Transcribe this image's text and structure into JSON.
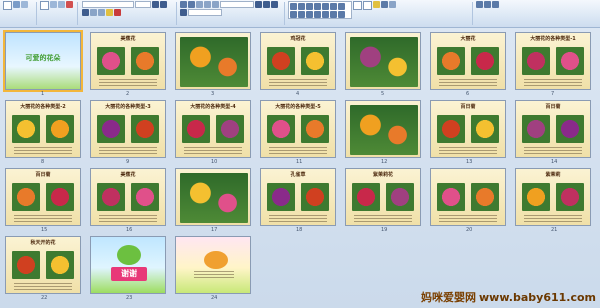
{
  "slides": [
    {
      "num": "1",
      "title": "可爱的花朵"
    },
    {
      "num": "2",
      "title": "美蕉花"
    },
    {
      "num": "3",
      "title": ""
    },
    {
      "num": "4",
      "title": "鸡冠花"
    },
    {
      "num": "5",
      "title": ""
    },
    {
      "num": "6",
      "title": "大丽花"
    },
    {
      "num": "7",
      "title": "大丽花的各种类型-1"
    },
    {
      "num": "8",
      "title": "大丽花的各种类型-2"
    },
    {
      "num": "9",
      "title": "大丽花的各种类型-3"
    },
    {
      "num": "10",
      "title": "大丽花的各种类型-4"
    },
    {
      "num": "11",
      "title": "大丽花的各种类型-5"
    },
    {
      "num": "12",
      "title": ""
    },
    {
      "num": "13",
      "title": "百日菊"
    },
    {
      "num": "14",
      "title": "百日菊"
    },
    {
      "num": "15",
      "title": "百日菊"
    },
    {
      "num": "16",
      "title": "美蕉花"
    },
    {
      "num": "17",
      "title": ""
    },
    {
      "num": "18",
      "title": "孔雀草"
    },
    {
      "num": "19",
      "title": "紫茉莉花"
    },
    {
      "num": "20",
      "title": ""
    },
    {
      "num": "21",
      "title": "紫茉莉"
    },
    {
      "num": "22",
      "title": "秋天开的花"
    },
    {
      "num": "23",
      "title": ""
    },
    {
      "num": "24",
      "title": ""
    }
  ],
  "thank_you": "谢谢",
  "watermark": {
    "cn": "妈咪爱婴网",
    "url": "www.baby611.com"
  },
  "colors": {
    "selection": "#f3b63a",
    "slide_bg": "#f5e8b8"
  }
}
